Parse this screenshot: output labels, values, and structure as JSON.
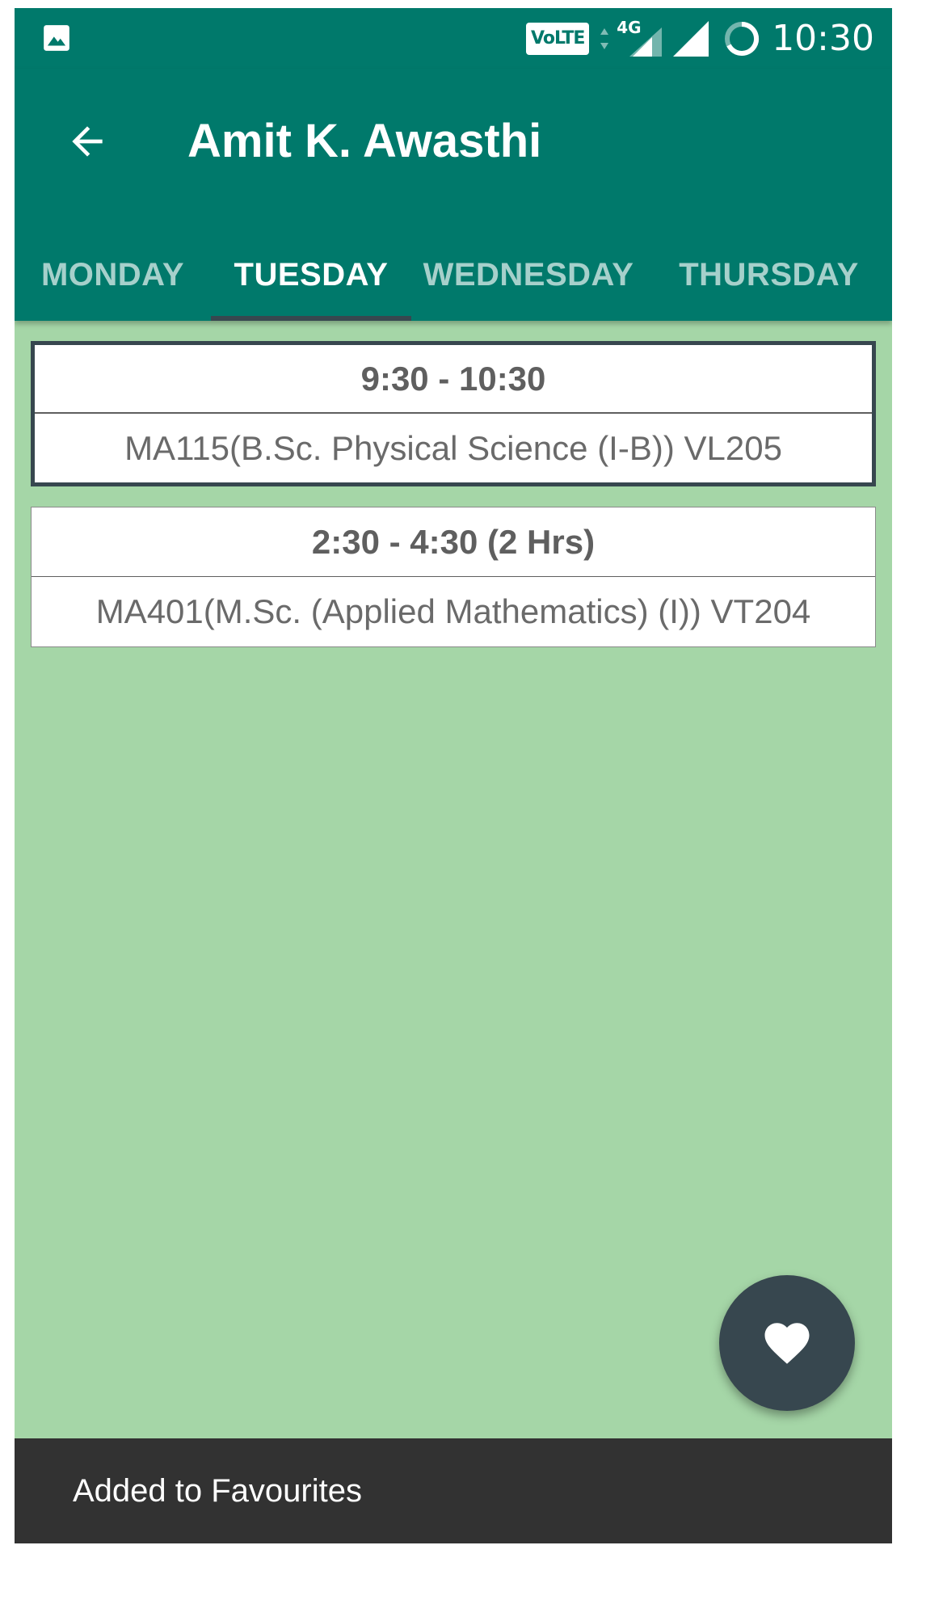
{
  "status_bar": {
    "left_icon": "gallery-image-icon",
    "volte_label": "VoLTE",
    "network_label": "4G",
    "time": "10:30"
  },
  "app_bar": {
    "back_icon": "arrow-back-icon",
    "title": "Amit K. Awasthi"
  },
  "tabs": [
    {
      "label": "MONDAY",
      "active": false
    },
    {
      "label": "TUESDAY",
      "active": true
    },
    {
      "label": "WEDNESDAY",
      "active": false
    },
    {
      "label": "THURSDAY",
      "active": false
    }
  ],
  "schedule": [
    {
      "time": "9:30 - 10:30",
      "course": "MA115(B.Sc. Physical Science (I-B)) VL205"
    },
    {
      "time": "2:30 - 4:30 (2 Hrs)",
      "course": "MA401(M.Sc. (Applied Mathematics) (I)) VT204"
    }
  ],
  "fab": {
    "icon": "heart-icon"
  },
  "snackbar": {
    "message": "Added to Favourites"
  },
  "colors": {
    "primary": "#00796b",
    "background": "#a5d6a7",
    "accent_dark": "#37474f",
    "snackbar": "#323232"
  }
}
